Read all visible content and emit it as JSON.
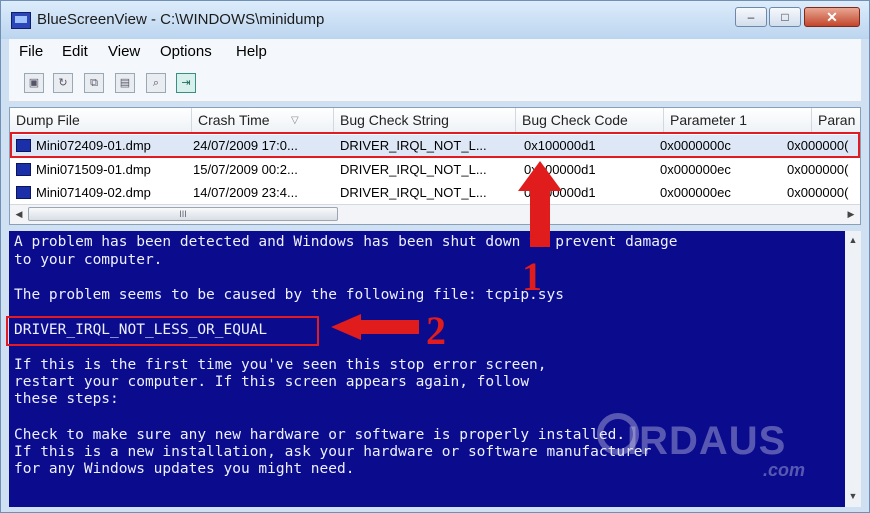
{
  "window": {
    "title": "BlueScreenView  -  C:\\WINDOWS\\minidump",
    "controls": {
      "minimize": "–",
      "maximize": "□",
      "close": "✕"
    }
  },
  "menu": [
    "File",
    "Edit",
    "View",
    "Options",
    "Help"
  ],
  "toolbar": {
    "buttons": [
      "save-icon",
      "refresh-icon",
      "copy-icon",
      "properties-icon",
      "find-icon",
      "exit-icon"
    ]
  },
  "table": {
    "columns": [
      "Dump File",
      "Crash Time",
      "Bug Check String",
      "Bug Check Code",
      "Parameter 1",
      "Paran"
    ],
    "rows": [
      [
        "Mini072409-01.dmp",
        "24/07/2009 17:0...",
        "DRIVER_IRQL_NOT_L...",
        "0x100000d1",
        "0x0000000c",
        "0x000000("
      ],
      [
        "Mini071509-01.dmp",
        "15/07/2009 00:2...",
        "DRIVER_IRQL_NOT_L...",
        "0x100000d1",
        "0x000000ec",
        "0x000000("
      ],
      [
        "Mini071409-02.dmp",
        "14/07/2009 23:4...",
        "DRIVER_IRQL_NOT_L...",
        "0x100000d1",
        "0x000000ec",
        "0x000000("
      ]
    ],
    "selected_row": 0
  },
  "scroll": {
    "left": "◀",
    "right": "▶",
    "up": "▲",
    "down": "▼",
    "thumb": "III"
  },
  "bsod_lines": [
    "A problem has been detected and Windows has been shut down to prevent damage",
    "to your computer.",
    "The problem seems to be caused by the following file: tcpip.sys",
    "DRIVER_IRQL_NOT_LESS_OR_EQUAL",
    "If this is the first time you've seen this stop error screen,",
    "restart your computer. If this screen appears again, follow",
    "these steps:",
    "Check to make sure any new hardware or software is properly installed.",
    "If this is a new installation, ask your hardware or software manufacturer",
    "for any Windows updates you might need."
  ],
  "annotations": {
    "label1": "1",
    "label2": "2",
    "arrow_color": "#e01c1c"
  },
  "watermark": {
    "text": "IRDAUS",
    "suffix": ".com"
  },
  "colors": {
    "bsod_bg": "#0a0b8d",
    "bsod_text": "#eef0ff",
    "highlight": "#e11b22"
  }
}
